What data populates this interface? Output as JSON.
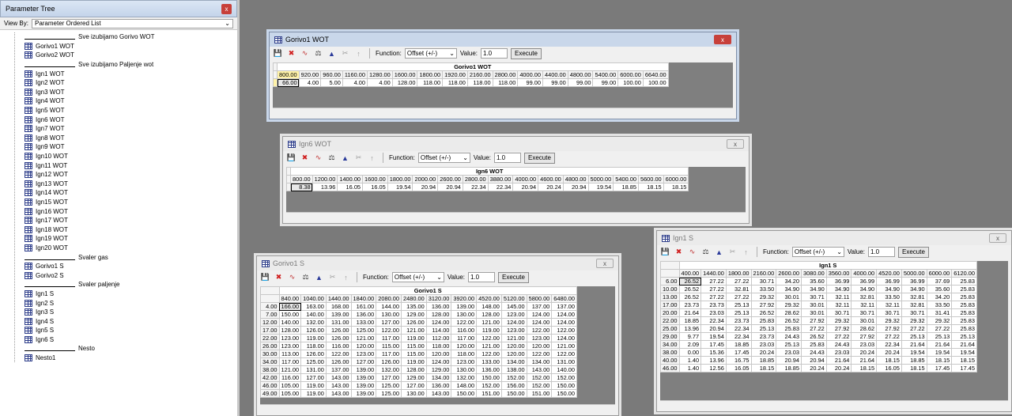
{
  "tree": {
    "title": "Parameter Tree",
    "close_glyph": "x",
    "view_by_label": "View By:",
    "view_by_value": "Parameter Ordered List",
    "items": [
      {
        "type": "sep",
        "label": "Sve izubijamo Gorivo WOT"
      },
      {
        "type": "param",
        "label": "Gorivo1 WOT"
      },
      {
        "type": "param",
        "label": "Gorivo2 WOT"
      },
      {
        "type": "sep",
        "label": "Sve izubijamo Paljenje wot"
      },
      {
        "type": "param",
        "label": "Ign1 WOT"
      },
      {
        "type": "param",
        "label": "Ign2 WOT"
      },
      {
        "type": "param",
        "label": "Ign3 WOT"
      },
      {
        "type": "param",
        "label": "Ign4 WOT"
      },
      {
        "type": "param",
        "label": "Ign5 WOT"
      },
      {
        "type": "param",
        "label": "Ign6 WOT"
      },
      {
        "type": "param",
        "label": "Ign7 WOT"
      },
      {
        "type": "param",
        "label": "Ign8 WOT"
      },
      {
        "type": "param",
        "label": "Ign9 WOT"
      },
      {
        "type": "param",
        "label": "Ign10 WOT"
      },
      {
        "type": "param",
        "label": "Ign11 WOT"
      },
      {
        "type": "param",
        "label": "Ign12 WOT"
      },
      {
        "type": "param",
        "label": "Ign13 WOT"
      },
      {
        "type": "param",
        "label": "Ign14 WOT"
      },
      {
        "type": "param",
        "label": "Ign15 WOT"
      },
      {
        "type": "param",
        "label": "Ign16 WOT"
      },
      {
        "type": "param",
        "label": "Ign17 WOT"
      },
      {
        "type": "param",
        "label": "Ign18 WOT"
      },
      {
        "type": "param",
        "label": "Ign19 WOT"
      },
      {
        "type": "param",
        "label": "Ign20 WOT"
      },
      {
        "type": "sep",
        "label": "Svaler gas"
      },
      {
        "type": "param",
        "label": "Gorivo1 S"
      },
      {
        "type": "param",
        "label": "Gorivo2 S"
      },
      {
        "type": "sep",
        "label": "Svaler paljenje"
      },
      {
        "type": "param",
        "label": "Ign1 S"
      },
      {
        "type": "param",
        "label": "Ign2 S"
      },
      {
        "type": "param",
        "label": "Ign3 S"
      },
      {
        "type": "param",
        "label": "Ign4 S"
      },
      {
        "type": "param",
        "label": "Ign5 S"
      },
      {
        "type": "param",
        "label": "Ign6 S"
      },
      {
        "type": "sep",
        "label": "Nesto"
      },
      {
        "type": "param",
        "label": "Nesto1"
      }
    ]
  },
  "toolbar": {
    "function_label": "Function:",
    "function_value": "Offset (+/-)",
    "value_label": "Value:",
    "value": "1.0",
    "execute_label": "Execute"
  },
  "windows": [
    {
      "id": "gorivo1-wot",
      "title": "Gorivo1 WOT",
      "active": true,
      "close_glyph": "x",
      "caption": "Gorivo1 WOT",
      "x_axis": [
        "800.00",
        "920.00",
        "960.00",
        "1160.00",
        "1280.00",
        "1600.00",
        "1800.00",
        "1920.00",
        "2160.00",
        "2800.00",
        "4000.00",
        "4400.00",
        "4800.00",
        "5400.00",
        "6000.00",
        "6640.00"
      ],
      "y_axis": [
        ""
      ],
      "rows": [
        [
          "66.00",
          "4.00",
          "5.00",
          "4.00",
          "4.00",
          "128.00",
          "118.00",
          "118.00",
          "118.00",
          "118.00",
          "99.00",
          "99.00",
          "99.00",
          "99.00",
          "100.00",
          "100.00"
        ]
      ]
    },
    {
      "id": "ign6-wot",
      "title": "Ign6 WOT",
      "active": false,
      "close_glyph": "x",
      "caption": "Ign6 WOT",
      "x_axis": [
        "800.00",
        "1200.00",
        "1400.00",
        "1600.00",
        "1800.00",
        "2000.00",
        "2600.00",
        "2800.00",
        "3880.00",
        "4000.00",
        "4600.00",
        "4800.00",
        "5000.00",
        "5400.00",
        "5600.00",
        "6000.00"
      ],
      "y_axis": [
        ""
      ],
      "rows": [
        [
          "8.38",
          "13.96",
          "16.05",
          "16.05",
          "19.54",
          "20.94",
          "20.94",
          "22.34",
          "22.34",
          "20.94",
          "20.24",
          "20.94",
          "19.54",
          "18.85",
          "18.15",
          "18.15"
        ]
      ]
    },
    {
      "id": "gorivo1-s",
      "title": "Gorivo1 S",
      "active": false,
      "close_glyph": "x",
      "caption": "Gorivo1 S",
      "x_axis": [
        "840.00",
        "1040.00",
        "1440.00",
        "1840.00",
        "2080.00",
        "2480.00",
        "3120.00",
        "3920.00",
        "4520.00",
        "5120.00",
        "5800.00",
        "6480.00"
      ],
      "y_axis": [
        "4.00",
        "7.00",
        "12.00",
        "17.00",
        "22.00",
        "26.00",
        "30.00",
        "34.00",
        "38.00",
        "42.00",
        "46.00",
        "49.00"
      ],
      "rows": [
        [
          "166.00",
          "163.00",
          "168.00",
          "161.00",
          "144.00",
          "135.00",
          "136.00",
          "139.00",
          "148.00",
          "145.00",
          "137.00",
          "137.00"
        ],
        [
          "150.00",
          "140.00",
          "139.00",
          "136.00",
          "130.00",
          "129.00",
          "128.00",
          "130.00",
          "128.00",
          "123.00",
          "124.00",
          "124.00"
        ],
        [
          "140.00",
          "132.00",
          "131.00",
          "133.00",
          "127.00",
          "126.00",
          "124.00",
          "122.00",
          "121.00",
          "124.00",
          "124.00",
          "124.00"
        ],
        [
          "128.00",
          "126.00",
          "126.00",
          "125.00",
          "122.00",
          "121.00",
          "114.00",
          "116.00",
          "119.00",
          "123.00",
          "122.00",
          "122.00"
        ],
        [
          "123.00",
          "119.00",
          "126.00",
          "121.00",
          "117.00",
          "119.00",
          "112.00",
          "117.00",
          "122.00",
          "121.00",
          "123.00",
          "124.00"
        ],
        [
          "123.00",
          "118.00",
          "116.00",
          "120.00",
          "115.00",
          "115.00",
          "118.00",
          "120.00",
          "121.00",
          "120.00",
          "120.00",
          "121.00"
        ],
        [
          "113.00",
          "126.00",
          "122.00",
          "123.00",
          "117.00",
          "115.00",
          "120.00",
          "118.00",
          "122.00",
          "120.00",
          "122.00",
          "122.00"
        ],
        [
          "117.00",
          "125.00",
          "126.00",
          "127.00",
          "126.00",
          "119.00",
          "124.00",
          "123.00",
          "133.00",
          "134.00",
          "134.00",
          "131.00"
        ],
        [
          "121.00",
          "131.00",
          "137.00",
          "139.00",
          "132.00",
          "128.00",
          "129.00",
          "130.00",
          "136.00",
          "138.00",
          "143.00",
          "140.00"
        ],
        [
          "116.00",
          "127.00",
          "143.00",
          "139.00",
          "127.00",
          "129.00",
          "134.00",
          "132.00",
          "150.00",
          "152.00",
          "152.00",
          "152.00"
        ],
        [
          "105.00",
          "119.00",
          "143.00",
          "139.00",
          "125.00",
          "127.00",
          "136.00",
          "148.00",
          "152.00",
          "156.00",
          "152.00",
          "150.00"
        ],
        [
          "105.00",
          "119.00",
          "143.00",
          "139.00",
          "125.00",
          "130.00",
          "143.00",
          "150.00",
          "151.00",
          "150.00",
          "151.00",
          "150.00"
        ]
      ]
    },
    {
      "id": "ign1-s",
      "title": "Ign1 S",
      "active": false,
      "close_glyph": "x",
      "caption": "Ign1 S",
      "x_axis": [
        "400.00",
        "1440.00",
        "1800.00",
        "2160.00",
        "2600.00",
        "3080.00",
        "3560.00",
        "4000.00",
        "4520.00",
        "5000.00",
        "6000.00",
        "6120.00"
      ],
      "y_axis": [
        "6.00",
        "10.00",
        "13.00",
        "17.00",
        "20.00",
        "22.00",
        "25.00",
        "29.00",
        "34.00",
        "38.00",
        "40.00",
        "46.00"
      ],
      "rows": [
        [
          "26.52",
          "27.22",
          "27.22",
          "30.71",
          "34.20",
          "35.60",
          "36.99",
          "36.99",
          "36.99",
          "36.99",
          "37.69",
          "25.83"
        ],
        [
          "26.52",
          "27.22",
          "32.81",
          "33.50",
          "34.90",
          "34.90",
          "34.90",
          "34.90",
          "34.90",
          "34.90",
          "35.60",
          "25.83"
        ],
        [
          "26.52",
          "27.22",
          "27.22",
          "29.32",
          "30.01",
          "30.71",
          "32.11",
          "32.81",
          "33.50",
          "32.81",
          "34.20",
          "25.83"
        ],
        [
          "23.73",
          "23.73",
          "25.13",
          "27.92",
          "29.32",
          "30.01",
          "32.11",
          "32.11",
          "32.11",
          "32.81",
          "33.50",
          "25.83"
        ],
        [
          "21.64",
          "23.03",
          "25.13",
          "26.52",
          "28.62",
          "30.01",
          "30.71",
          "30.71",
          "30.71",
          "30.71",
          "31.41",
          "25.83"
        ],
        [
          "18.85",
          "22.34",
          "23.73",
          "25.83",
          "26.52",
          "27.92",
          "29.32",
          "30.01",
          "29.32",
          "29.32",
          "29.32",
          "25.83"
        ],
        [
          "13.96",
          "20.94",
          "22.34",
          "25.13",
          "25.83",
          "27.22",
          "27.92",
          "28.62",
          "27.92",
          "27.22",
          "27.22",
          "25.83"
        ],
        [
          "9.77",
          "19.54",
          "22.34",
          "23.73",
          "24.43",
          "26.52",
          "27.22",
          "27.92",
          "27.22",
          "25.13",
          "25.13",
          "25.13"
        ],
        [
          "2.09",
          "17.45",
          "18.85",
          "23.03",
          "25.13",
          "25.83",
          "24.43",
          "23.03",
          "22.34",
          "21.64",
          "21.64",
          "21.64"
        ],
        [
          "0.00",
          "15.36",
          "17.45",
          "20.24",
          "23.03",
          "24.43",
          "23.03",
          "20.24",
          "20.24",
          "19.54",
          "19.54",
          "19.54"
        ],
        [
          "1.40",
          "13.96",
          "16.75",
          "18.85",
          "20.94",
          "20.94",
          "21.64",
          "21.64",
          "18.15",
          "18.85",
          "18.15",
          "18.15"
        ],
        [
          "1.40",
          "12.56",
          "16.05",
          "18.15",
          "18.85",
          "20.24",
          "20.24",
          "18.15",
          "16.05",
          "18.15",
          "17.45",
          "17.45"
        ]
      ]
    }
  ]
}
